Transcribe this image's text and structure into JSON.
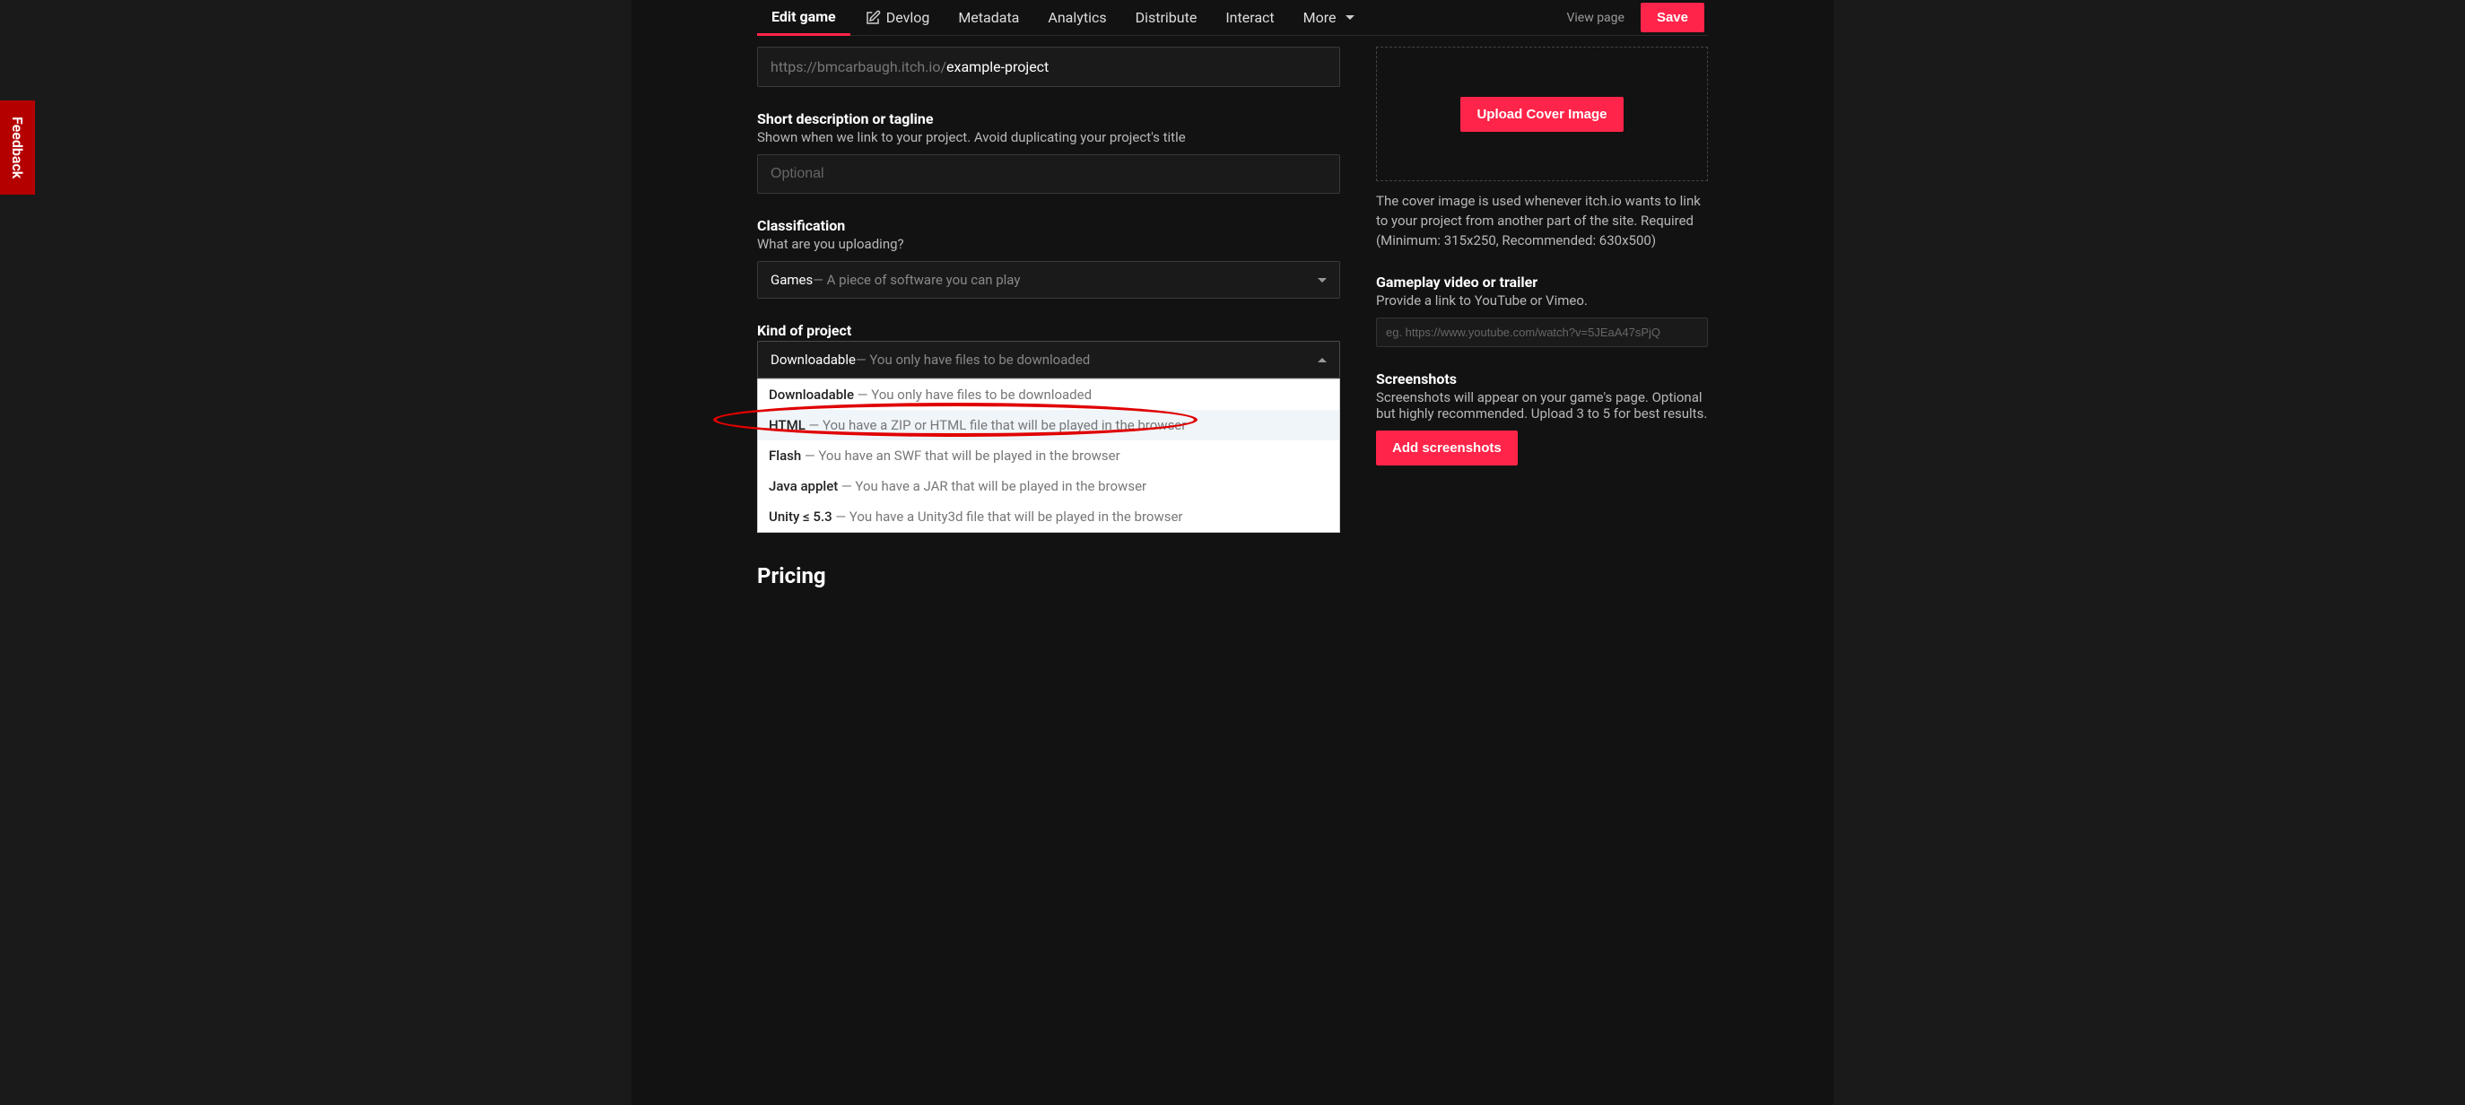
{
  "feedback_label": "Feedback",
  "nav": {
    "edit_game": "Edit game",
    "devlog": "Devlog",
    "metadata": "Metadata",
    "analytics": "Analytics",
    "distribute": "Distribute",
    "interact": "Interact",
    "more": "More",
    "view_page": "View page",
    "save": "Save"
  },
  "url_field": {
    "prefix": "https://bmcarbaugh.itch.io/",
    "slug": "example-project"
  },
  "tagline": {
    "label": "Short description or tagline",
    "sub": "Shown when we link to your project. Avoid duplicating your project's title",
    "placeholder": "Optional"
  },
  "classification": {
    "label": "Classification",
    "sub": "What are you uploading?",
    "selected_main": "Games",
    "selected_hint": " — A piece of software you can play"
  },
  "kind": {
    "label": "Kind of project",
    "selected_main": "Downloadable",
    "selected_hint": " — You only have files to be downloaded",
    "options": [
      {
        "main": "Downloadable",
        "hint": " — You only have files to be downloaded"
      },
      {
        "main": "HTML",
        "hint": " — You have a ZIP or HTML file that will be played in the browser"
      },
      {
        "main": "Flash",
        "hint": " — You have an SWF that will be played in the browser"
      },
      {
        "main": "Java applet",
        "hint": " — You have a JAR that will be played in the browser"
      },
      {
        "main": "Unity ≤ 5.3",
        "hint": " — You have a Unity3d file that will be played in the browser"
      }
    ]
  },
  "pricing_heading": "Pricing",
  "cover": {
    "button": "Upload Cover Image",
    "desc": "The cover image is used whenever itch.io wants to link to your project from another part of the site. Required (Minimum: 315x250, Recommended: 630x500)"
  },
  "trailer": {
    "label": "Gameplay video or trailer",
    "sub": "Provide a link to YouTube or Vimeo.",
    "placeholder": "eg. https://www.youtube.com/watch?v=5JEaA47sPjQ"
  },
  "screenshots": {
    "label": "Screenshots",
    "sub": "Screenshots will appear on your game's page. Optional but highly recommended. Upload 3 to 5 for best results.",
    "button": "Add screenshots"
  }
}
